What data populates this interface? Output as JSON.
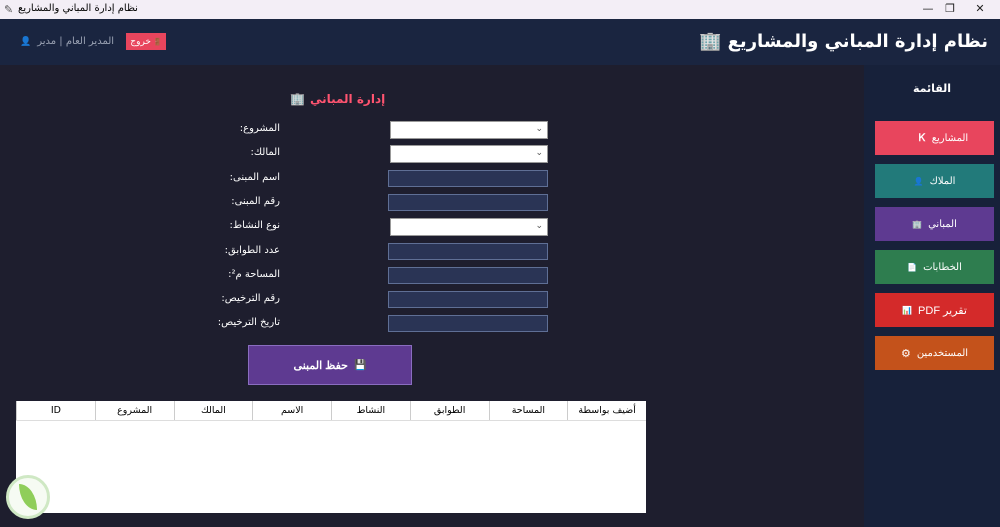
{
  "window": {
    "title": "نظام إدارة المباني والمشاريع",
    "icon": "feather-icon",
    "controls": [
      "—",
      "❐",
      "✕"
    ]
  },
  "header": {
    "title": "نظام إدارة المباني والمشاريع",
    "title_icon": "🏢",
    "logout_label": "خروج",
    "logout_icon": "🚪",
    "user_text": "المدير العام | مدير",
    "user_icon": "👤"
  },
  "form": {
    "title": "إدارة المباني",
    "title_icon": "🏢",
    "fields": [
      {
        "label": ":المشروع",
        "type": "select",
        "value": ""
      },
      {
        "label": ":المالك",
        "type": "select",
        "value": ""
      },
      {
        "label": ":اسم المبنى",
        "type": "text",
        "value": ""
      },
      {
        "label": ":رقم المبنى",
        "type": "text",
        "value": ""
      },
      {
        "label": ":نوع النشاط",
        "type": "select",
        "value": ""
      },
      {
        "label": ":عدد الطوابق",
        "type": "text",
        "value": ""
      },
      {
        "label": ":المساحة م²",
        "type": "text",
        "value": ""
      },
      {
        "label": ":رقم الترخيص",
        "type": "text",
        "value": ""
      },
      {
        "label": ":تاريخ الترخيص",
        "type": "text",
        "value": ""
      }
    ],
    "save_label": "حفظ المبنى",
    "save_icon": "💾"
  },
  "table": {
    "columns": [
      "أضيف بواسطة",
      "المساحة",
      "الطوابق",
      "النشاط",
      "الاسم",
      "المالك",
      "المشروع",
      "ID"
    ],
    "rows": []
  },
  "sidebar": {
    "heading": "القائمة",
    "items": [
      {
        "label": "المشاريع",
        "icon": "Ꮶ",
        "color": "#e8455d"
      },
      {
        "label": "الملاك",
        "icon": "👤",
        "color": "#227a7a"
      },
      {
        "label": "المباني",
        "icon": "🏢",
        "color": "#5e3a91"
      },
      {
        "label": "الخطابات",
        "icon": "📄",
        "color": "#2e7d4f"
      },
      {
        "label": "تقرير PDF",
        "icon": "📊",
        "color": "#d42a2a"
      },
      {
        "label": "المستخدمين",
        "icon": "⚙",
        "color": "#c4521b"
      }
    ]
  }
}
